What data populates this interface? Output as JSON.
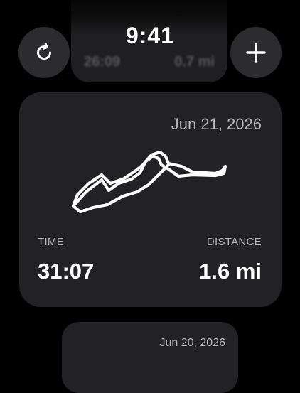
{
  "status_bar": {
    "time": "9:41"
  },
  "toolbar": {
    "left_button": {
      "icon": "refresh-icon"
    },
    "right_button": {
      "icon": "plus-icon"
    }
  },
  "previous_card": {
    "time": "26:09",
    "distance": "0.7 mi"
  },
  "workout_card": {
    "date": "Jun 21, 2026",
    "time_label": "TIME",
    "time_value": "31:07",
    "distance_label": "DISTANCE",
    "distance_value": "1.6 mi",
    "route_icon": "route-map"
  },
  "next_card": {
    "date": "Jun 20, 2026"
  },
  "colors": {
    "background": "#000000",
    "card": "#222224",
    "button": "#2c2c2e",
    "primary_text": "#ffffff",
    "secondary_text": "#b9b9bd"
  }
}
